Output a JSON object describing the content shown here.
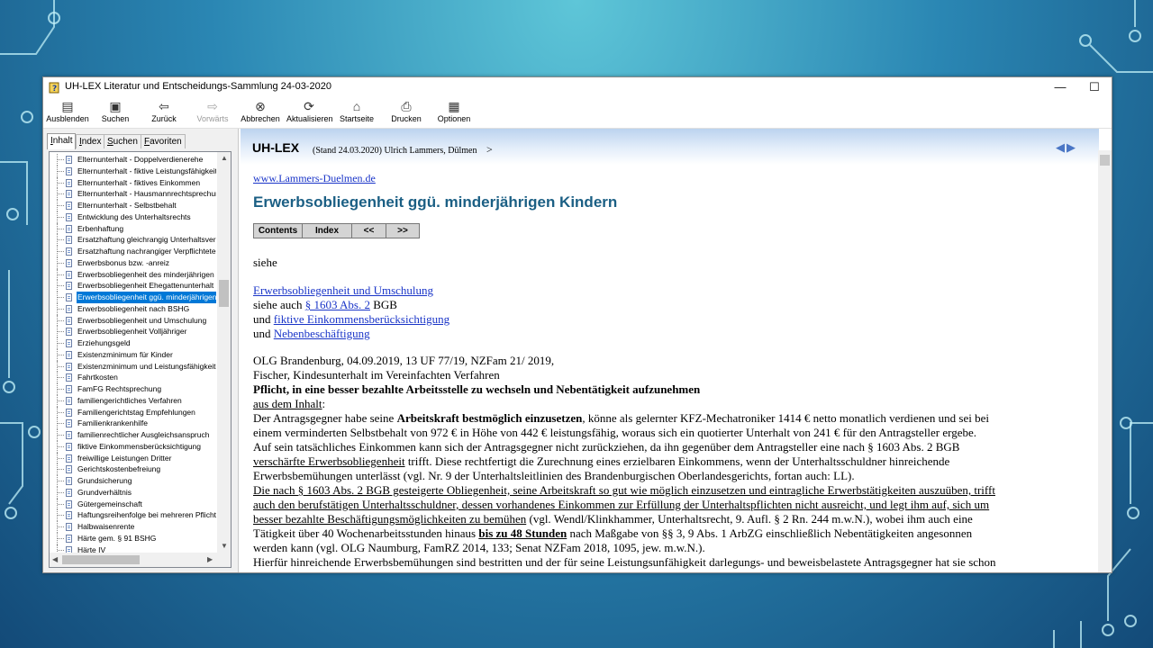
{
  "window": {
    "title": "UH-LEX Literatur und Entscheidungs-Sammlung 24-03-2020",
    "controls": {
      "minimize": "—",
      "maximize": "☐",
      "close": "✕"
    }
  },
  "toolbar": [
    {
      "label": "Ausblenden",
      "icon": "hide-icon",
      "enabled": true
    },
    {
      "label": "Suchen",
      "icon": "search-icon",
      "enabled": true
    },
    {
      "label": "Zurück",
      "icon": "back-arrow-icon",
      "enabled": true
    },
    {
      "label": "Vorwärts",
      "icon": "forward-arrow-icon",
      "enabled": false
    },
    {
      "label": "Abbrechen",
      "icon": "stop-icon",
      "enabled": true
    },
    {
      "label": "Aktualisieren",
      "icon": "refresh-icon",
      "enabled": true
    },
    {
      "label": "Startseite",
      "icon": "home-icon",
      "enabled": true
    },
    {
      "label": "Drucken",
      "icon": "print-icon",
      "enabled": true
    },
    {
      "label": "Optionen",
      "icon": "options-icon",
      "enabled": true
    }
  ],
  "tabs": [
    "Inhalt",
    "Index",
    "Suchen",
    "Favoriten"
  ],
  "active_tab": "Inhalt",
  "tree_items": [
    "Elternunterhalt - Doppelverdienerehe",
    "Elternunterhalt - fiktive Leistungsfähigkeit",
    "Elternunterhalt - fiktives Einkommen",
    "Elternunterhalt - Hausmannrechtsprechung",
    "Elternunterhalt - Selbstbehalt",
    "Entwicklung des Unterhaltsrechts",
    "Erbenhaftung",
    "Ersatzhaftung gleichrangig Unterhaltsverpflichteter",
    "Ersatzhaftung nachrangiger Verpflichteter",
    "Erwerbsbonus bzw. -anreiz",
    "Erwerbsobliegenheit des minderjährigen Kindes",
    "Erwerbsobliegenheit Ehegattenunterhalt",
    "Erwerbsobliegenheit ggü. minderjährigen Kindern",
    "Erwerbsobliegenheit nach BSHG",
    "Erwerbsobliegenheit und Umschulung",
    "Erwerbsobliegenheit Volljähriger",
    "Erziehungsgeld",
    "Existenzminimum für Kinder",
    "Existenzminimum und Leistungsfähigkeit",
    "Fahrtkosten",
    "FamFG Rechtsprechung",
    "familiengerichtliches Verfahren",
    "Familiengerichtstag Empfehlungen",
    "Familienkrankenhilfe",
    "familienrechtlicher Ausgleichsanspruch",
    "fiktive Einkommensberücksichtigung",
    "freiwillige Leistungen Dritter",
    "Gerichtskostenbefreiung",
    "Grundsicherung",
    "Grundverhältnis",
    "Gütergemeinschaft",
    "Haftungsreihenfolge bei mehreren Pflichtigen",
    "Halbwaisenrente",
    "Härte gem. § 91 BSHG",
    "Härte IV"
  ],
  "selected_index": 12,
  "content": {
    "brand": "UH-LEX",
    "stand": "(Stand 24.03.2020) Ulrich Lammers, Dülmen",
    "stand_arrow": ">",
    "website": "www.Lammers-Duelmen.de",
    "heading": "Erwerbsobliegenheit ggü. minderjährigen Kindern",
    "nav_buttons": [
      "Contents",
      "Index",
      "<<",
      ">>"
    ],
    "siehe": "siehe",
    "refs": {
      "link1": "Erwerbsobliegenheit und Umschulung",
      "siehe_auch": "siehe auch",
      "link2": "§ 1603 Abs. 2",
      "bgb": "BGB",
      "und1": "und",
      "link3": "fiktive Einkommensberücksichtigung",
      "und2": "und",
      "link4": "Nebenbeschäftigung"
    },
    "case_line1": "OLG Brandenburg, 04.09.2019, 13 UF 77/19, NZFam 21/ 2019,",
    "case_line2": "Fischer, Kindesunterhalt im Vereinfachten Verfahren",
    "case_bold": "Pflicht, in eine besser bezahlte Arbeitsstelle zu wechseln und Nebentätigkeit aufzunehmen",
    "aus_dem_inhalt": "aus dem Inhalt",
    "colon": ":",
    "body": {
      "l1a": "Der Antragsgegner habe seine ",
      "l1b": "Arbeitskraft bestmöglich einzusetzen",
      "l1c": ", könne als gelernter KFZ-Mechatroniker 1414 € netto monatlich verdienen und sei bei",
      "l2": "einem verminderten Selbstbehalt von 972 € in Höhe von 442 € leistungsfähig, woraus sich ein quotierter Unterhalt von 241 € für den Antragsteller ergebe.",
      "l3": "Auf sein tatsächliches Einkommen kann sich der Antragsgegner nicht zurückziehen, da ihn gegenüber dem Antragsteller eine nach § 1603 Abs. 2 BGB",
      "l4a": "verschärfte Erwerbsobliegenheit",
      "l4b": " trifft. Diese rechtfertigt die Zurechnung eines erzielbaren Einkommens, wenn der Unterhaltsschuldner hinreichende",
      "l5": "Erwerbsbemühungen unterlässt (vgl. Nr. 9 der Unterhaltsleitlinien des Brandenburgischen Oberlandesgerichts, fortan auch: LL).",
      "l6": "Die nach § 1603 Abs. 2 BGB gesteigerte Obliegenheit, seine Arbeitskraft so gut wie möglich einzusetzen und eintragliche Erwerbstätigkeiten auszuüben, trifft",
      "l7": "auch den berufstätigen Unterhaltsschuldner, dessen vorhandenes Einkommen zur Erfüllung der Unterhaltspflichten nicht ausreicht, und legt ihm auf, sich um",
      "l8a": "besser bezahlte Beschäftigungsmöglichkeiten zu bemühen",
      "l8b": " (vgl. Wendl/Klinkhammer, Unterhaltsrecht, 9. Aufl. § 2 Rn. 244 m.w.N.), wobei ihm auch eine",
      "l9a": "Tätigkeit über 40 Wochenarbeitsstunden hinaus ",
      "l9b": "bis zu 48 Stunden",
      "l9c": " nach Maßgabe von §§ 3, 9 Abs. 1 ArbZG einschließlich Nebentätigkeiten angesonnen",
      "l10": "werden kann (vgl. OLG Naumburg, FamRZ 2014, 133; Senat NZFam 2018, 1095, jew. m.w.N.).",
      "l11": "Hierfür hinreichende Erwerbsbemühungen sind bestritten und der für seine Leistungsunfähigkeit darlegungs- und beweisbelastete Antragsgegner hat sie schon"
    }
  }
}
